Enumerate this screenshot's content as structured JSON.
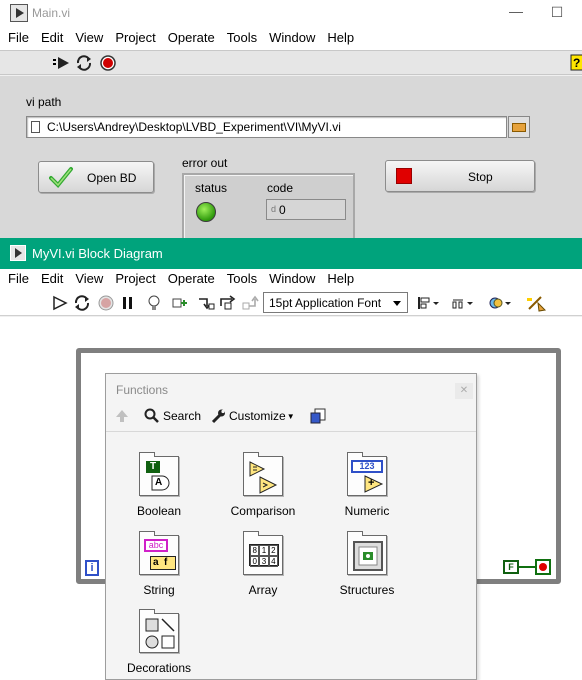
{
  "front_panel": {
    "title": "Main.vi",
    "menu": [
      "File",
      "Edit",
      "View",
      "Project",
      "Operate",
      "Tools",
      "Window",
      "Help"
    ],
    "toolbar_icons": [
      "run-arrow-icon",
      "run-continuously-icon",
      "abort-icon",
      "help-icon"
    ],
    "vi_path": {
      "label": "vi path",
      "value": "C:\\Users\\Andrey\\Desktop\\LVBD_Experiment\\VI\\MyVI.vi"
    },
    "open_bd_button": {
      "label": "Open BD"
    },
    "stop_button": {
      "label": "Stop"
    },
    "error_out": {
      "label": "error out",
      "status_label": "status",
      "code_label": "code",
      "code_radix": "d",
      "code_value": "0",
      "status_color": "#3cbf1a"
    }
  },
  "block_diagram": {
    "title": "MyVI.vi Block Diagram",
    "title_bar_color": "#00a37c",
    "menu": [
      "File",
      "Edit",
      "View",
      "Project",
      "Operate",
      "Tools",
      "Window",
      "Help"
    ],
    "font_select": "15pt Application Font",
    "iteration_label": "i",
    "false_constant_label": "F"
  },
  "functions_palette": {
    "title": "Functions",
    "search_label": "Search",
    "customize_label": "Customize",
    "categories": [
      {
        "label": "Boolean",
        "icon": "boolean-palette-icon"
      },
      {
        "label": "Comparison",
        "icon": "comparison-palette-icon"
      },
      {
        "label": "Numeric",
        "icon": "numeric-palette-icon"
      },
      {
        "label": "String",
        "icon": "string-palette-icon"
      },
      {
        "label": "Array",
        "icon": "array-palette-icon"
      },
      {
        "label": "Structures",
        "icon": "structures-palette-icon"
      },
      {
        "label": "Decorations",
        "icon": "decorations-palette-icon"
      }
    ],
    "glyphs": {
      "boolean_t": "T",
      "boolean_a": "A",
      "numeric_digits": "123",
      "numeric_plus": "+",
      "string_text": "abc",
      "string_sub": "a",
      "string_f": "f",
      "array_cells": [
        "8",
        "1",
        "2",
        "0",
        "3",
        "4"
      ]
    }
  }
}
